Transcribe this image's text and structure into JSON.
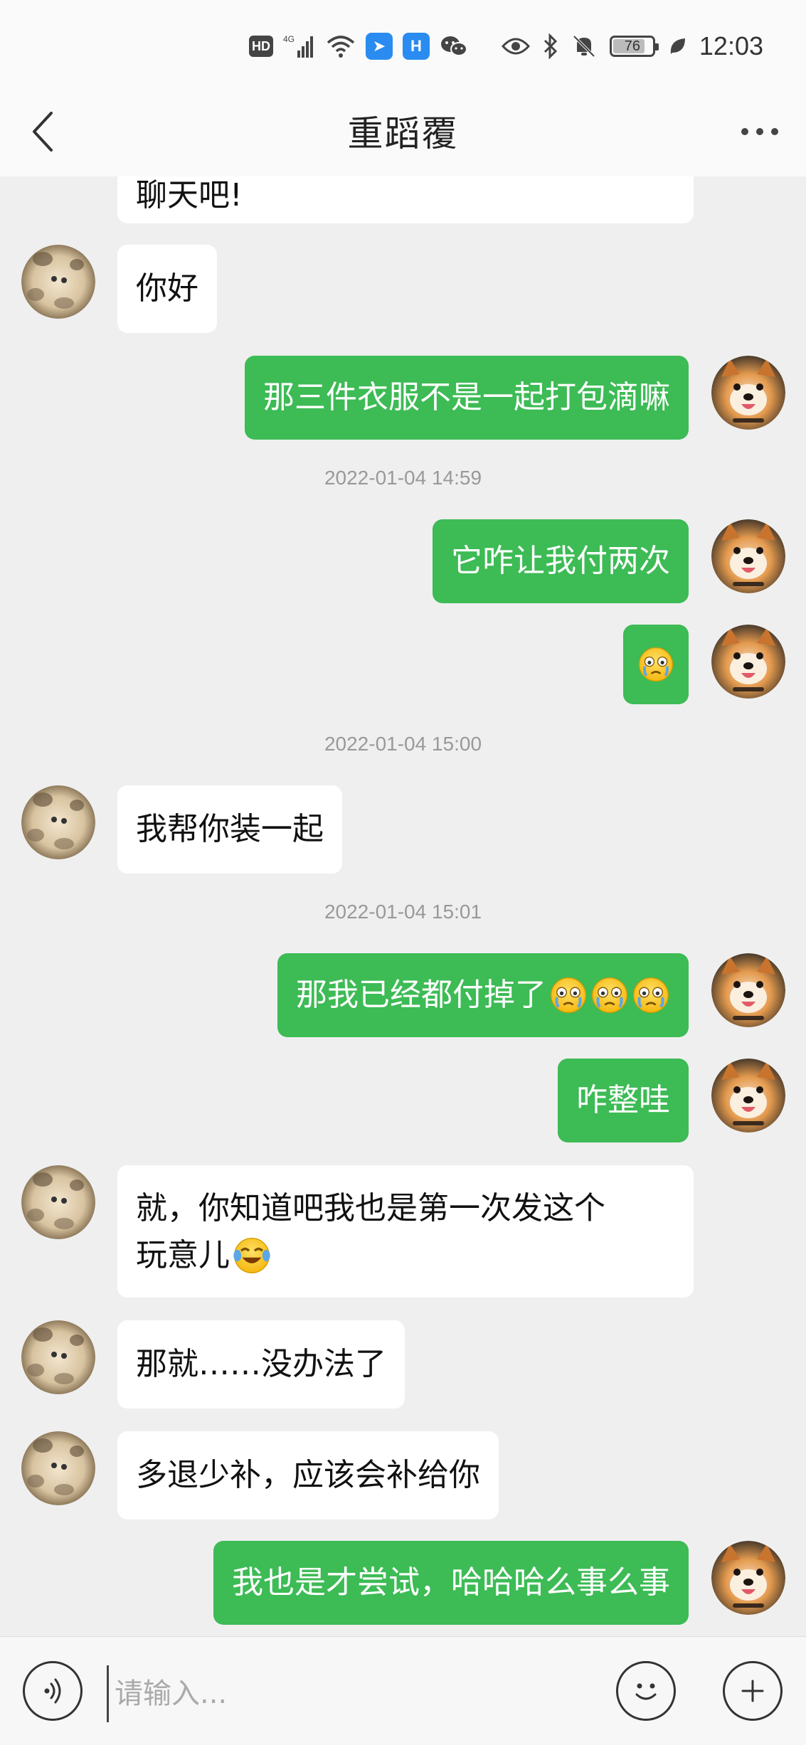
{
  "status_bar": {
    "hd": "HD",
    "network": "4G",
    "battery": "76",
    "time": "12:03",
    "icons": [
      "hd-icon",
      "signal-4g-icon",
      "wifi-icon",
      "app-feishu-icon",
      "app-h-icon",
      "wechat-icon",
      "eye-icon",
      "bluetooth-icon",
      "mute-icon",
      "battery-icon",
      "leaf-icon"
    ]
  },
  "header": {
    "title": "重蹈覆",
    "back_icon": "chevron-left-icon",
    "more_icon": "more-dots-icon"
  },
  "messages": [
    {
      "dir": "in",
      "text": "聊天吧!"
    },
    {
      "dir": "in",
      "text": "你好"
    },
    {
      "dir": "out",
      "text": "那三件衣服不是一起打包滴嘛"
    },
    {
      "dir": "time",
      "text": "2022-01-04 14:59"
    },
    {
      "dir": "out",
      "text": "它咋让我付两次"
    },
    {
      "dir": "out",
      "text": "",
      "emoji": [
        "crying-face"
      ]
    },
    {
      "dir": "time",
      "text": "2022-01-04 15:00"
    },
    {
      "dir": "in",
      "text": "我帮你装一起"
    },
    {
      "dir": "time",
      "text": "2022-01-04 15:01"
    },
    {
      "dir": "out",
      "text": "那我已经都付掉了",
      "emoji": [
        "crying-face",
        "crying-face",
        "crying-face"
      ]
    },
    {
      "dir": "out",
      "text": "咋整哇"
    },
    {
      "dir": "in",
      "text": "就，你知道吧我也是第一次发这个玩意儿",
      "line1": "就，你知道吧我也是第一次发这个",
      "line2": "玩意儿",
      "emoji": [
        "laughing-tears-face"
      ]
    },
    {
      "dir": "in",
      "text": "那就……没办法了"
    },
    {
      "dir": "in",
      "text": "多退少补，应该会补给你"
    },
    {
      "dir": "out",
      "text": "我也是才尝试，哈哈哈么事么事"
    }
  ],
  "input": {
    "placeholder": "请输入...",
    "voice_icon": "voice-icon",
    "emoji_icon": "emoji-icon",
    "plus_icon": "plus-icon"
  },
  "colors": {
    "out_bubble": "#3dbb55",
    "in_bubble": "#ffffff",
    "background": "#efefef"
  }
}
